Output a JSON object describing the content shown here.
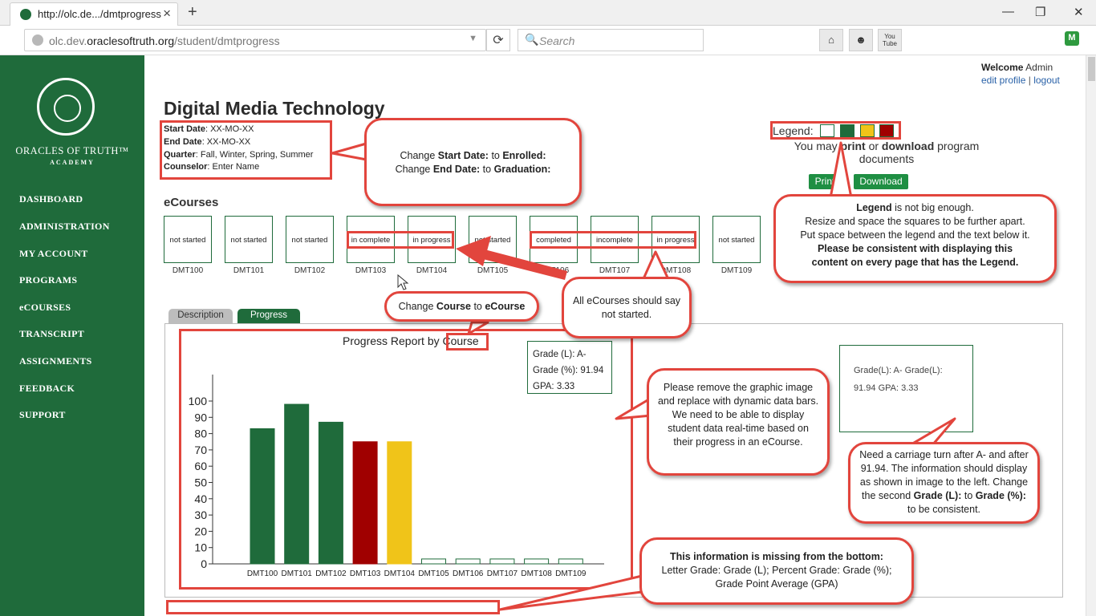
{
  "browser": {
    "tab_title": "http://olc.de.../dmtprogress",
    "url_prefix": "olc.dev.",
    "url_domain": "oraclesoftruth.org",
    "url_path": "/student/dmtprogress",
    "search_placeholder": "Search",
    "reload_glyph": "⟳",
    "search_glyph": "🔍",
    "home_glyph": "⌂",
    "smile_glyph": "☻",
    "youtube_text": "You Tube",
    "ext_text": "M"
  },
  "sidebar": {
    "brand": "ORACLES OF TRUTH™",
    "brand_sub": "ACADEMY",
    "items": [
      {
        "label": "DASHBOARD"
      },
      {
        "label": "ADMINISTRATION"
      },
      {
        "label": "MY ACCOUNT"
      },
      {
        "label": "PROGRAMS"
      },
      {
        "label": "eCOURSES"
      },
      {
        "label": "TRANSCRIPT"
      },
      {
        "label": "ASSIGNMENTS"
      },
      {
        "label": "FEEDBACK"
      },
      {
        "label": "SUPPORT"
      }
    ]
  },
  "header": {
    "welcome_label": "Welcome",
    "welcome_user": "Admin",
    "edit_profile": "edit profile",
    "separator": "|",
    "logout": "logout"
  },
  "page": {
    "title": "Digital Media Technology",
    "start_date_label": "Start Date",
    "start_date_value": ": XX-MO-XX",
    "end_date_label": "End Date",
    "end_date_value": ": XX-MO-XX",
    "quarter_label": "Quarter",
    "quarter_value": ": Fall, Winter, Spring, Summer",
    "counselor_label": "Counselor",
    "counselor_value": ": Enter Name"
  },
  "legend": {
    "label": "Legend:",
    "colors": [
      "#ffffff",
      "#1f6b3b",
      "#f0c419",
      "#a00000"
    ],
    "text_before": "You may ",
    "print_word": "print",
    "or_word": " or ",
    "download_word": "download",
    "text_after": " program documents",
    "print_button": "Print",
    "download_button": "Download"
  },
  "ecourses": {
    "heading": "eCourses",
    "items": [
      {
        "status": "not started",
        "code": "DMT100"
      },
      {
        "status": "not started",
        "code": "DMT101"
      },
      {
        "status": "not started",
        "code": "DMT102"
      },
      {
        "status": "in complete",
        "code": "DMT103"
      },
      {
        "status": "in progress",
        "code": "DMT104"
      },
      {
        "status": "not started",
        "code": "DMT105"
      },
      {
        "status": "completed",
        "code": "DMT106"
      },
      {
        "status": "incomplete",
        "code": "DMT107"
      },
      {
        "status": "in progress",
        "code": "DMT108"
      },
      {
        "status": "not started",
        "code": "DMT109"
      }
    ]
  },
  "tabs": {
    "description": "Description",
    "progress": "Progress"
  },
  "chart_data": {
    "type": "bar",
    "title": "Progress Report by Course",
    "categories": [
      "DMT100",
      "DMT101",
      "DMT102",
      "DMT103",
      "DMT104",
      "DMT105",
      "DMT106",
      "DMT107",
      "DMT108",
      "DMT109"
    ],
    "values": [
      83,
      98,
      87,
      75,
      75,
      3,
      3,
      3,
      3,
      3
    ],
    "colors": [
      "#1f6b3b",
      "#1f6b3b",
      "#1f6b3b",
      "#a00000",
      "#f0c419",
      "#ffffff",
      "#ffffff",
      "#ffffff",
      "#ffffff",
      "#ffffff"
    ],
    "yticks": [
      0,
      10,
      20,
      30,
      40,
      50,
      60,
      70,
      80,
      90,
      100
    ],
    "ylim": [
      0,
      115
    ],
    "grid": false
  },
  "grades": {
    "box1_line1": "Grade (L):  A-",
    "box1_line2": "Grade (%): 91.94",
    "box1_line3": "GPA: 3.33",
    "box2_line1": "Grade(L): A- Grade(L):",
    "box2_line2": "91.94 GPA: 3.33"
  },
  "annotations": {
    "dates_a": "Change ",
    "dates_b": "Start Date:",
    "dates_c": " to ",
    "dates_d": "Enrolled:",
    "dates_e": "Change ",
    "dates_f": "End Date:",
    "dates_g": " to ",
    "dates_h": "Graduation:",
    "legend_a": "Legend",
    "legend_b": " is not big enough.",
    "legend_c": "Resize and space the squares to be further apart.",
    "legend_d": "Put space between the legend and the text below it.",
    "legend_e": "Please be consistent with displaying this content on every page that has the Legend.",
    "course_a": "Change ",
    "course_b": "Course",
    "course_c": " to ",
    "course_d": "eCourse",
    "not_started": "All eCourses should say not started.",
    "graphic": "Please remove the graphic image and replace with dynamic data bars. We need to be able to display student data real-time based on their progress in an eCourse.",
    "carriage_a": "Need a carriage turn after A- and after 91.94. The information should display as shown in image to the left. Change the second ",
    "carriage_b": "Grade (L):",
    "carriage_c": " to ",
    "carriage_d": "Grade (%):",
    "carriage_e": " to be consistent.",
    "missing_a": "This information is missing from the bottom:",
    "missing_b": "Letter Grade: Grade (L); Percent Grade: Grade (%);",
    "missing_c": "Grade Point Average (GPA)"
  }
}
